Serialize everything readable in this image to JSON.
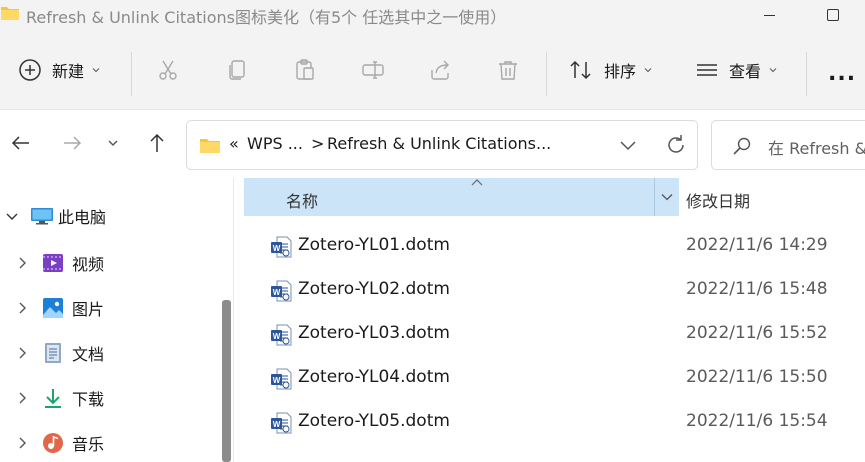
{
  "window": {
    "title": "Refresh & Unlink Citations图标美化（有5个 任选其中之一使用）"
  },
  "commands": {
    "new_label": "新建",
    "sort_label": "排序",
    "view_label": "查看",
    "more_label": "..."
  },
  "address": {
    "overflow": "«",
    "crumb1": "WPS ...",
    "separator": ">",
    "crumb2": "Refresh & Unlink Citations..."
  },
  "search": {
    "placeholder": "在 Refresh &"
  },
  "navpane": {
    "items": [
      {
        "label": "此电脑",
        "icon": "computer-icon"
      },
      {
        "label": "视频",
        "icon": "videos-icon"
      },
      {
        "label": "图片",
        "icon": "pictures-icon"
      },
      {
        "label": "文档",
        "icon": "documents-icon"
      },
      {
        "label": "下载",
        "icon": "downloads-icon"
      },
      {
        "label": "音乐",
        "icon": "music-icon"
      }
    ]
  },
  "filelist": {
    "columns": {
      "name": "名称",
      "date": "修改日期"
    },
    "files": [
      {
        "name": "Zotero-YL01.dotm",
        "date": "2022/11/6 14:29"
      },
      {
        "name": "Zotero-YL02.dotm",
        "date": "2022/11/6 15:48"
      },
      {
        "name": "Zotero-YL03.dotm",
        "date": "2022/11/6 15:52"
      },
      {
        "name": "Zotero-YL04.dotm",
        "date": "2022/11/6 15:50"
      },
      {
        "name": "Zotero-YL05.dotm",
        "date": "2022/11/6 15:54"
      }
    ]
  },
  "colors": {
    "header_selected": "#cce4f7",
    "folder": "#f5c542",
    "word_blue": "#2b579a"
  }
}
